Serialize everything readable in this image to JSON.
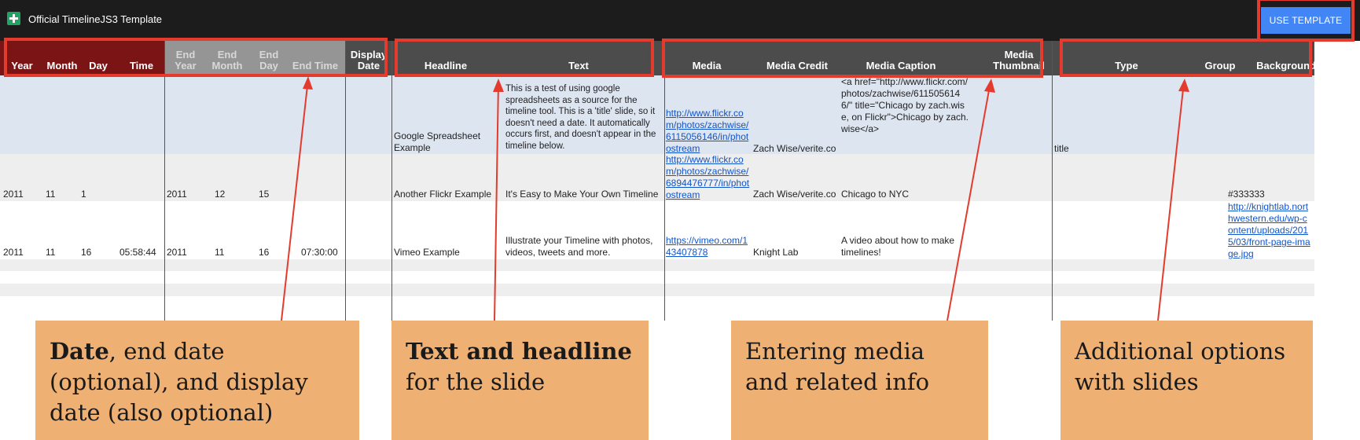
{
  "app": {
    "title": "Official TimelineJS3 Template",
    "use_template_label": "USE TEMPLATE"
  },
  "colors": {
    "topbar": "#1c1c1c",
    "header_date": "#7b1414",
    "header_end": "#959595",
    "header_dark": "#4c4c4c",
    "row_title": "#dde5f0",
    "row_alt": "#eeeeee",
    "highlight": "#e33b2e",
    "callout": "#efb073",
    "button": "#4285f4"
  },
  "headers": {
    "year": "Year",
    "month": "Month",
    "day": "Day",
    "time": "Time",
    "end_year": "End Year",
    "end_month": "End Month",
    "end_day": "End Day",
    "end_time": "End Time",
    "display_date": "Display Date",
    "headline": "Headline",
    "text": "Text",
    "media": "Media",
    "media_credit": "Media Credit",
    "media_caption": "Media Caption",
    "media_thumbnail": "Media Thumbnail",
    "type": "Type",
    "group": "Group",
    "background": "Background"
  },
  "rows": [
    {
      "year": "",
      "month": "",
      "day": "",
      "time": "",
      "end_year": "",
      "end_month": "",
      "end_day": "",
      "end_time": "",
      "display_date": "",
      "headline": "Google Spreadsheet Example",
      "text": "This is a test of using google spreadsheets as a source for the timeline tool. This is a 'title' slide, so it doesn't need a date. It automatically occurs first, and doesn't appear in the timeline below.",
      "media": "http://www.flickr.com/photos/zachwise/6115056146/in/photostream",
      "media_credit": "Zach Wise/verite.co",
      "media_caption": "<a href=\"http://www.flickr.com/photos/zachwise/6115056146/\" title=\"Chicago by zach.wise, on Flickr\">Chicago by zach.wise</a>",
      "media_thumbnail": "",
      "type": "title",
      "group": "",
      "background": ""
    },
    {
      "year": "2011",
      "month": "11",
      "day": "1",
      "time": "",
      "end_year": "2011",
      "end_month": "12",
      "end_day": "15",
      "end_time": "",
      "display_date": "",
      "headline": "Another Flickr Example",
      "text": "It's Easy to Make Your Own Timeline",
      "media": "http://www.flickr.com/photos/zachwise/6894476777/in/photostream",
      "media_credit": "Zach Wise/verite.co",
      "media_caption": "Chicago to NYC",
      "media_thumbnail": "",
      "type": "",
      "group": "",
      "background": "#333333"
    },
    {
      "year": "2011",
      "month": "11",
      "day": "16",
      "time": "05:58:44",
      "end_year": "2011",
      "end_month": "11",
      "end_day": "16",
      "end_time": "07:30:00",
      "display_date": "",
      "headline": "Vimeo Example",
      "text": "Illustrate your Timeline with photos, videos, tweets and more.",
      "media": "https://vimeo.com/143407878",
      "media_credit": "Knight Lab",
      "media_caption": "A video about how to make timelines!",
      "media_thumbnail": "",
      "type": "",
      "group": "",
      "background": "http://knightlab.northwestern.edu/wp-content/uploads/2015/03/front-page-image.jpg"
    }
  ],
  "callouts": [
    {
      "bold": "Date",
      "text": ", end date (optional), and display date (also optional)"
    },
    {
      "bold": "Text and headline",
      "text": " for the slide"
    },
    {
      "bold": "",
      "text": "Entering media and related info"
    },
    {
      "bold": "",
      "text": "Additional options with slides"
    }
  ]
}
